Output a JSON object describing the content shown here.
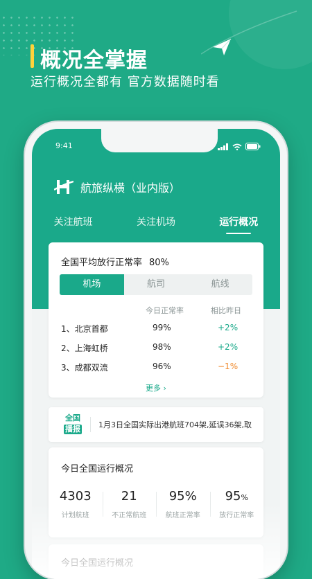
{
  "hero": {
    "title": "概况全掌握",
    "subtitle": "运行概况全都有 官方数据随时看"
  },
  "status": {
    "time": "9:41"
  },
  "app": {
    "name": "航旅纵横（业内版）"
  },
  "tabs": [
    {
      "label": "关注航班"
    },
    {
      "label": "关注机场"
    },
    {
      "label": "运行概况"
    }
  ],
  "overview": {
    "label": "全国平均放行正常率",
    "value": "80%",
    "segments": [
      "机场",
      "航司",
      "航线"
    ],
    "columns": [
      "今日正常率",
      "相比昨日"
    ],
    "rows": [
      {
        "name": "1、北京首都",
        "rate": "99%",
        "change": "+2%"
      },
      {
        "name": "2、上海虹桥",
        "rate": "98%",
        "change": "+2%"
      },
      {
        "name": "3、成都双流",
        "rate": "96%",
        "change": "−1%"
      }
    ],
    "more": "更多"
  },
  "broadcast": {
    "badge_top": "全国",
    "badge_bottom": "播报",
    "text": "1月3日全国实际出港航班704架,延误36架,取"
  },
  "today": {
    "title": "今日全国运行概况",
    "stats": [
      {
        "value": "4303",
        "unit": "",
        "label": "计划航班"
      },
      {
        "value": "21",
        "unit": "",
        "label": "不正常航班"
      },
      {
        "value": "95%",
        "unit": "",
        "label": "航班正常率"
      },
      {
        "value": "95",
        "unit": "%",
        "label": "放行正常率"
      }
    ]
  },
  "next_card": {
    "title": "今日全国运行概况"
  },
  "colors": {
    "brand": "#1aa98a",
    "accent": "#ffd23a",
    "negative": "#f08a2c"
  }
}
